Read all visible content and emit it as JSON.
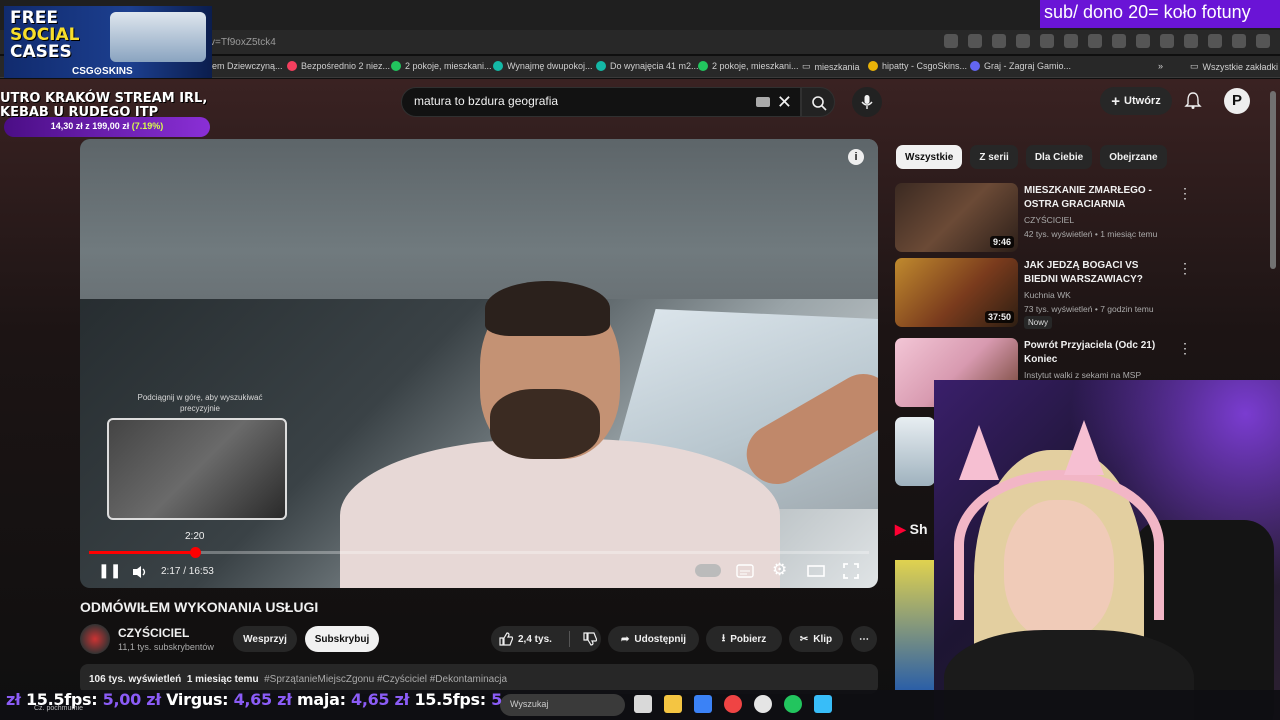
{
  "browser": {
    "url": "v=Tf9oxZ5tck4",
    "bookmarks": [
      "em Dziewczyną...",
      "Bezpośrednio 2 niez...",
      "2 pokoje, mieszkani...",
      "Wynajmę dwupokoj...",
      "Do wynajęcia 41 m2...",
      "2 pokoje, mieszkani...",
      "mieszkania",
      "hipatty - CsgoSkins...",
      "Graj - Zagraj Gamio...",
      "Wszystkie zakładki"
    ]
  },
  "yt": {
    "search_value": "matura to bzdura geografia",
    "create_label": "Utwórz",
    "avatar_letter": "P",
    "player": {
      "swipe_hint": "Podciągnij w górę, aby wyszukiwać precyzyjnie",
      "preview_time": "2:20",
      "time_display": "2:17 / 16:53",
      "progress_fraction": 0.136
    },
    "video_title": "ODMÓWIŁEM WYKONANIA USŁUGI",
    "channel": {
      "name": "CZYŚCICIEL",
      "subs": "11,1 tys. subskrybentów"
    },
    "buttons": {
      "support": "Wesprzyj",
      "subscribe": "Subskrybuj",
      "likes": "2,4 tys.",
      "share": "Udostępnij",
      "download": "Pobierz",
      "clip": "Klip"
    },
    "description": {
      "views": "106 tys. wyświetleń",
      "date": "1 miesiąc temu",
      "tags": "#SprzątanieMiejscZgonu #Czyściciel #Dekontaminacja"
    },
    "chips": [
      "Wszystkie",
      "Z serii",
      "Dla Ciebie",
      "Obejrzane"
    ],
    "recommended": [
      {
        "title": "MIESZKANIE ZMARŁEGO - OSTRA GRACIARNIA",
        "channel": "CZYŚCICIEL",
        "meta": "42 tys. wyświetleń • 1 miesiąc temu",
        "duration": "9:46",
        "thumb_color": "#6b4a36"
      },
      {
        "title": "JAK JEDZĄ BOGACI VS BIEDNI WARSZAWIACY?",
        "channel": "Kuchnia WK",
        "meta": "73 tys. wyświetleń • 7 godzin temu",
        "duration": "37:50",
        "thumb_color": "#c08a2e",
        "badge": "Nowy"
      },
      {
        "title": "Powrót Przyjaciela (Odc 21) Koniec",
        "channel": "Instytut walki z sekami na MSP",
        "meta": "",
        "duration": "",
        "thumb_color": "#d89ab0"
      }
    ],
    "shorts_label": "Sh"
  },
  "overlays": {
    "promo": {
      "line1": "FREE",
      "line2": "SOCIAL",
      "line3": "CASES",
      "brand": "CSG⊙SKINS"
    },
    "stream_title": "UTRO KRAKÓW STREAM IRL, KEBAB U RUDEGO ITP",
    "goal": {
      "text": "14,30 zł z 199,00 zł",
      "pct": "(7.19%)"
    },
    "sub_banner": "sub/ dono 20= koło fotuny",
    "donors": [
      {
        "name": "15.5fps:",
        "amount": "5,00 zł"
      },
      {
        "name": "Virgus:",
        "amount": "4,65 zł"
      },
      {
        "name": "maja:",
        "amount": "4,65 zł"
      },
      {
        "name": "15.5fps:",
        "amount": "5"
      }
    ],
    "ticker_lead": "zł",
    "taskbar_search": "Wyszukaj",
    "taskbar_sub": "Cz. pochmurnie"
  },
  "colors": {
    "accent_red": "#ff0000",
    "goal_purple": "#8a2fd6",
    "banner_purple": "#6a14d6",
    "donor_amount": "#8b5cf6"
  }
}
